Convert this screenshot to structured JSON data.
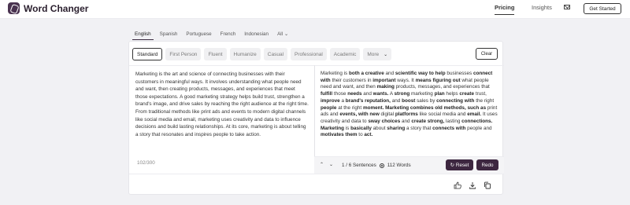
{
  "header": {
    "brand": "Word Changer",
    "nav": [
      "Pricing",
      "Insights"
    ],
    "cta": "Get Started",
    "icons": {
      "logo": "wordchanger-logo-icon",
      "mail": "mail-icon"
    }
  },
  "languages": {
    "items": [
      "English",
      "Spanish",
      "Portuguese",
      "French",
      "Indonesian",
      "All"
    ],
    "active": "English"
  },
  "modes": {
    "items": [
      "Standard",
      "First Person",
      "Fluent",
      "Humanize",
      "Casual",
      "Professional",
      "Academic",
      "More"
    ],
    "active": "Standard",
    "clear_label": "Clear"
  },
  "input": {
    "text": "Marketing is the art and science of connecting businesses with their customers in meaningful ways. It involves understanding what people need and want, then creating products, messages, and experiences that meet those expectations. A good marketing strategy helps build trust, strengthen a brand's image, and drive sales by reaching the right audience at the right time. From traditional methods like print ads and events to modern digital channels like social media and email, marketing uses creativity and data to influence decisions and build lasting relationships. At its core, marketing is about telling a story that resonates and inspires people to take action.",
    "counter": "102/300"
  },
  "output": {
    "segments": [
      {
        "t": "Marketing is ",
        "b": false
      },
      {
        "t": "both a creative",
        "b": true
      },
      {
        "t": " and ",
        "b": false
      },
      {
        "t": "scientific way to help",
        "b": true
      },
      {
        "t": " businesses ",
        "b": false
      },
      {
        "t": "connect with",
        "b": true
      },
      {
        "t": " their customers in ",
        "b": false
      },
      {
        "t": "important",
        "b": true
      },
      {
        "t": " ways. It ",
        "b": false
      },
      {
        "t": "means figuring out",
        "b": true
      },
      {
        "t": " what people need and want, and then ",
        "b": false
      },
      {
        "t": "making",
        "b": true
      },
      {
        "t": " products, messages, and experiences that ",
        "b": false
      },
      {
        "t": "fulfill",
        "b": true
      },
      {
        "t": " those ",
        "b": false
      },
      {
        "t": "needs",
        "b": true
      },
      {
        "t": " and ",
        "b": false
      },
      {
        "t": "wants.",
        "b": true
      },
      {
        "t": " A ",
        "b": false
      },
      {
        "t": "strong",
        "b": true
      },
      {
        "t": " marketing ",
        "b": false
      },
      {
        "t": "plan",
        "b": true
      },
      {
        "t": " helps ",
        "b": false
      },
      {
        "t": "create",
        "b": true
      },
      {
        "t": " trust, ",
        "b": false
      },
      {
        "t": "improve",
        "b": true
      },
      {
        "t": " a ",
        "b": false
      },
      {
        "t": "brand's reputation,",
        "b": true
      },
      {
        "t": " and ",
        "b": false
      },
      {
        "t": "boost",
        "b": true
      },
      {
        "t": " sales by ",
        "b": false
      },
      {
        "t": "connecting with",
        "b": true
      },
      {
        "t": " the right ",
        "b": false
      },
      {
        "t": "people",
        "b": true
      },
      {
        "t": " at the right ",
        "b": false
      },
      {
        "t": "moment. Marketing combines old methods, such as",
        "b": true
      },
      {
        "t": " print ads and ",
        "b": false
      },
      {
        "t": "events, with new",
        "b": true
      },
      {
        "t": " digital ",
        "b": false
      },
      {
        "t": "platforms",
        "b": true
      },
      {
        "t": " like social media and ",
        "b": false
      },
      {
        "t": "email.",
        "b": true
      },
      {
        "t": " It uses creativity and data to ",
        "b": false
      },
      {
        "t": "sway choices",
        "b": true
      },
      {
        "t": " and ",
        "b": false
      },
      {
        "t": "create strong,",
        "b": true
      },
      {
        "t": " lasting ",
        "b": false
      },
      {
        "t": "connections. Marketing",
        "b": true
      },
      {
        "t": " is ",
        "b": false
      },
      {
        "t": "basically",
        "b": true
      },
      {
        "t": " about ",
        "b": false
      },
      {
        "t": "sharing",
        "b": true
      },
      {
        "t": " a story that ",
        "b": false
      },
      {
        "t": "connects with",
        "b": true
      },
      {
        "t": " people and ",
        "b": false
      },
      {
        "t": "motivates them",
        "b": true
      },
      {
        "t": " to ",
        "b": false
      },
      {
        "t": "act.",
        "b": true
      }
    ],
    "sentences": "1 / 6 Sentences",
    "words": "112 Words",
    "reset_label": "Reset",
    "redo_label": "Redo"
  },
  "actions": {
    "icons": [
      "thumbs-up-icon",
      "download-icon",
      "copy-icon"
    ]
  }
}
